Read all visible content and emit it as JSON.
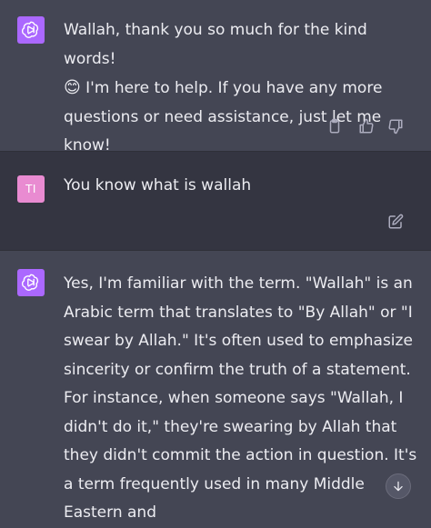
{
  "messages": [
    {
      "role": "assistant",
      "text_line1": "Wallah, thank you so much for the kind words!",
      "emoji": "😊",
      "text_rest": " I'm here to help. If you have any more questions or need assistance, just let me know!"
    },
    {
      "role": "user",
      "avatar_initials": "TI",
      "text": "You know what is wallah"
    },
    {
      "role": "assistant",
      "text": "Yes, I'm familiar with the term. \"Wallah\" is an Arabic term that translates to \"By Allah\" or \"I swear by Allah.\" It's often used to emphasize sincerity or confirm the truth of a statement. For instance, when someone says \"Wallah, I didn't do it,\" they're swearing by Allah that they didn't commit the action in question. It's a term frequently used in many Middle Eastern and"
    }
  ],
  "icons": {
    "assistant_avatar": "openai-logo-icon",
    "copy": "clipboard-icon",
    "thumbs_up": "thumbs-up-icon",
    "thumbs_down": "thumbs-down-icon",
    "edit": "edit-icon",
    "scroll_down": "arrow-down-icon"
  },
  "colors": {
    "assistant_bg": "#444654",
    "user_bg": "#343541",
    "gpt_avatar": "#ab68ff",
    "user_avatar": "#e98bd1",
    "text": "#ececf1",
    "icon": "#acacbe"
  }
}
